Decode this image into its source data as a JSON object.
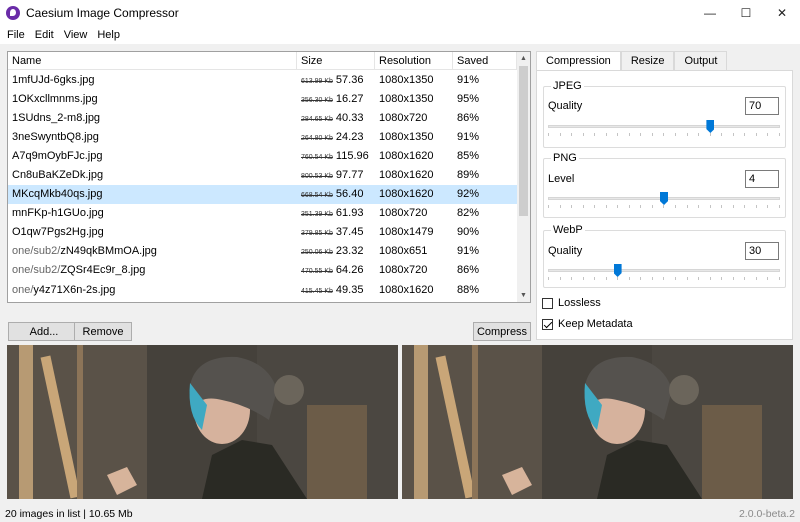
{
  "window": {
    "title": "Caesium Image Compressor",
    "controls": {
      "minimize": "—",
      "maximize": "☐",
      "close": "✕"
    }
  },
  "menu": [
    "File",
    "Edit",
    "View",
    "Help"
  ],
  "table": {
    "columns": [
      "Name",
      "Size",
      "Resolution",
      "Saved"
    ],
    "rows": [
      {
        "name": "1mfUJd-6gks.jpg",
        "orig": "613.99 Kb",
        "size": "57.36",
        "res": "1080x1350",
        "saved": "91%"
      },
      {
        "name": "1OKxcllmnms.jpg",
        "orig": "356.30 Kb",
        "size": "16.27",
        "res": "1080x1350",
        "saved": "95%"
      },
      {
        "name": "1SUdns_2-m8.jpg",
        "orig": "284.65 Kb",
        "size": "40.33",
        "res": "1080x720",
        "saved": "86%"
      },
      {
        "name": "3neSwyntbQ8.jpg",
        "orig": "264.80 Kb",
        "size": "24.23",
        "res": "1080x1350",
        "saved": "91%"
      },
      {
        "name": "A7q9mOybFJc.jpg",
        "orig": "760.54 Kb",
        "size": "115.96",
        "res": "1080x1620",
        "saved": "85%"
      },
      {
        "name": "Cn8uBaKZeDk.jpg",
        "orig": "800.53 Kb",
        "size": "97.77",
        "res": "1080x1620",
        "saved": "89%"
      },
      {
        "name": "MKcqMkb40qs.jpg",
        "orig": "668.54 Kb",
        "size": "56.40",
        "res": "1080x1620",
        "saved": "92%",
        "selected": true
      },
      {
        "name": "mnFKp-h1GUo.jpg",
        "orig": "351.39 Kb",
        "size": "61.93",
        "res": "1080x720",
        "saved": "82%"
      },
      {
        "name": "O1qw7Pgs2Hg.jpg",
        "orig": "379.85 Kb",
        "size": "37.45",
        "res": "1080x1479",
        "saved": "90%"
      },
      {
        "name": "one/sub2/zN49qkBMmOA.jpg",
        "prefix": "one/sub2/",
        "file": "zN49qkBMmOA.jpg",
        "orig": "250.06 Kb",
        "size": "23.32",
        "res": "1080x651",
        "saved": "91%"
      },
      {
        "name": "one/sub2/ZQSr4Ec9r_8.jpg",
        "prefix": "one/sub2/",
        "file": "ZQSr4Ec9r_8.jpg",
        "orig": "470.55 Kb",
        "size": "64.26",
        "res": "1080x720",
        "saved": "86%"
      },
      {
        "name": "one/y4z71X6n-2s.jpg",
        "prefix": "one/",
        "file": "y4z71X6n-2s.jpg",
        "orig": "415.45 Kb",
        "size": "49.35",
        "res": "1080x1620",
        "saved": "88%"
      }
    ]
  },
  "buttons": {
    "add": "Add...",
    "remove": "Remove",
    "compress": "Compress"
  },
  "tabs": [
    "Compression",
    "Resize",
    "Output"
  ],
  "compression": {
    "jpeg": {
      "title": "JPEG",
      "label": "Quality",
      "value": "70",
      "slider": 0.7
    },
    "png": {
      "title": "PNG",
      "label": "Level",
      "value": "4",
      "slider": 0.5
    },
    "webp": {
      "title": "WebP",
      "label": "Quality",
      "value": "30",
      "slider": 0.3
    },
    "lossless": {
      "label": "Lossless",
      "checked": false
    },
    "keep_metadata": {
      "label": "Keep Metadata",
      "checked": true
    }
  },
  "status": {
    "left": "20 images in list | 10.65 Mb",
    "version": "2.0.0-beta.2"
  }
}
